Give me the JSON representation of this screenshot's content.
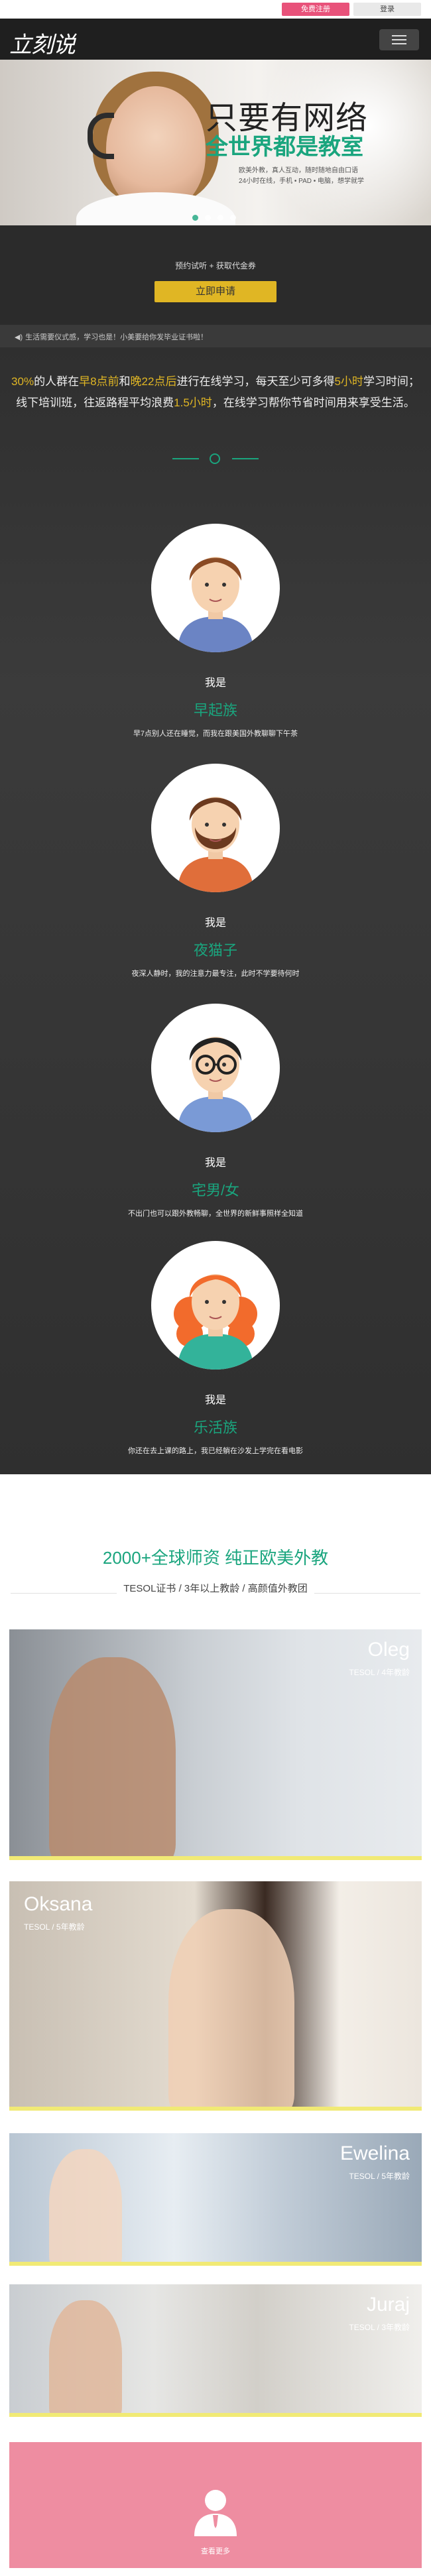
{
  "topbar": {
    "register": "免费注册",
    "login": "登录"
  },
  "header": {
    "logo": "立刻说"
  },
  "hero": {
    "title": "只要有网络",
    "subtitle": "全世界都是教室",
    "lines": [
      "欧美外教，真人互动，随时随地自由口语",
      "24小时在线，手机 • PAD • 电脑，想学就学"
    ]
  },
  "apply": {
    "text": "预约试听 + 获取代金券",
    "button": "立即申请"
  },
  "ticker": {
    "text": "生活需要仪式感，学习也是！小美要给你发毕业证书啦！"
  },
  "intro": {
    "parts": [
      {
        "t": "30%",
        "hl": true
      },
      {
        "t": "的人群在",
        "hl": false
      },
      {
        "t": "早8点前",
        "hl": true
      },
      {
        "t": "和",
        "hl": false
      },
      {
        "t": "晚22点后",
        "hl": true
      },
      {
        "t": "进行在线学习，每天至少可多得",
        "hl": false
      },
      {
        "t": "5小时",
        "hl": true
      },
      {
        "t": "学习时间；线下培训班，往返路程平均浪费",
        "hl": false
      },
      {
        "t": "1.5小时",
        "hl": true
      },
      {
        "t": "，在线学习帮你节省时间用来享受生活。",
        "hl": false
      }
    ]
  },
  "personas": [
    {
      "label": "我是",
      "name": "早起族",
      "desc": "早7点别人还在睡觉，而我在跟美国外教聊聊下午茶",
      "hair": "#8a4b25",
      "shirt": "#6b84c4",
      "beard": false,
      "glasses": false
    },
    {
      "label": "我是",
      "name": "夜猫子",
      "desc": "夜深人静时，我的注意力最专注，此时不学要待何时",
      "hair": "#6b3a1f",
      "shirt": "#e06e3a",
      "beard": true,
      "glasses": false
    },
    {
      "label": "我是",
      "name": "宅男/女",
      "desc": "不出门也可以跟外教畅聊，全世界的新鲜事照样全知道",
      "hair": "#222222",
      "shirt": "#7a9ad6",
      "beard": false,
      "glasses": true
    },
    {
      "label": "我是",
      "name": "乐活族",
      "desc": "你还在去上课的路上，我已经躺在沙发上学完在看电影",
      "hair": "#f26b2c",
      "shirt": "#33b39a",
      "beard": false,
      "glasses": false
    }
  ],
  "teachers": {
    "title": "2000+全球师资 纯正欧美外教",
    "subtitle": "TESOL证书 / 3年以上教龄 / 高颜值外教团",
    "list": [
      {
        "name": "Oleg",
        "info": "TESOL / 4年教龄",
        "align": "right"
      },
      {
        "name": "Oksana",
        "info": "TESOL / 5年教龄",
        "align": "left"
      },
      {
        "name": "Ewelina",
        "info": "TESOL / 5年教龄",
        "align": "right"
      },
      {
        "name": "Juraj",
        "info": "TESOL / 3年教龄",
        "align": "right"
      }
    ],
    "more": "查看更多"
  },
  "colors": {
    "accent_green": "#1aa57e",
    "accent_yellow": "#e0b624",
    "pink": "#e8527a",
    "more_pink": "#ee8da1"
  },
  "icons": [
    "menu-icon",
    "speaker-icon",
    "user-icon"
  ]
}
